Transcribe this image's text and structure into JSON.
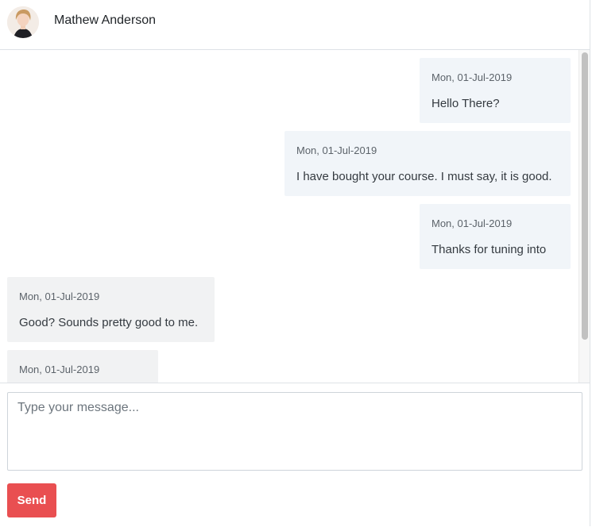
{
  "header": {
    "contact_name": "Mathew Anderson",
    "avatar_icon": "avatar-photo"
  },
  "messages": [
    {
      "direction": "outgoing",
      "timestamp": "Mon, 01-Jul-2019",
      "text": "Hello There?"
    },
    {
      "direction": "outgoing",
      "timestamp": "Mon, 01-Jul-2019",
      "text": "I have bought your course. I must say, it is good."
    },
    {
      "direction": "outgoing",
      "timestamp": "Mon, 01-Jul-2019",
      "text": "Thanks for tuning into"
    },
    {
      "direction": "incoming",
      "timestamp": "Mon, 01-Jul-2019",
      "text": "Good? Sounds pretty good to me."
    },
    {
      "direction": "incoming",
      "timestamp": "Mon, 01-Jul-2019",
      "text": ""
    }
  ],
  "composer": {
    "placeholder": "Type your message...",
    "value": "",
    "send_label": "Send"
  },
  "colors": {
    "send_button": "#e94f51",
    "outgoing_bubble": "#f1f5f9",
    "incoming_bubble": "#f1f2f3"
  }
}
